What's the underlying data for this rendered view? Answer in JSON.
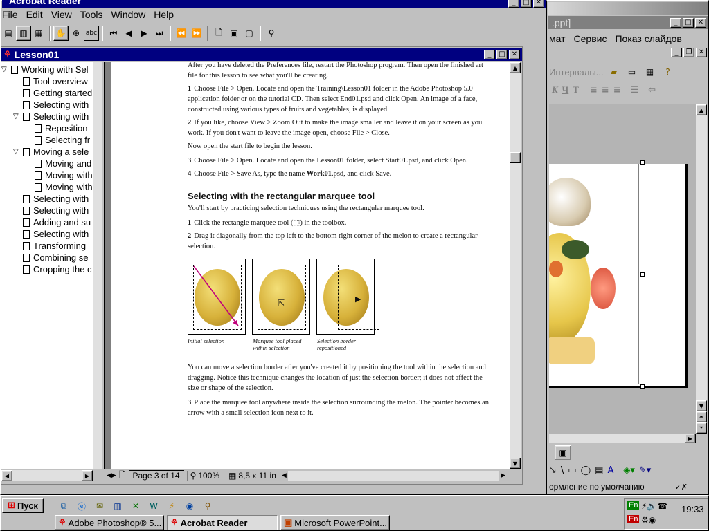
{
  "acrobat": {
    "title": "Acrobat Reader",
    "menu": [
      "File",
      "Edit",
      "View",
      "Tools",
      "Window",
      "Help"
    ],
    "doc_window_title": "Lesson01",
    "bookmarks": [
      {
        "label": "Working with Sel",
        "level": 0,
        "expanded": true
      },
      {
        "label": "Tool overview",
        "level": 1
      },
      {
        "label": "Getting started",
        "level": 1
      },
      {
        "label": "Selecting with",
        "level": 1
      },
      {
        "label": "Selecting with",
        "level": 1,
        "expanded": true
      },
      {
        "label": "Reposition",
        "level": 2
      },
      {
        "label": "Selecting fr",
        "level": 2
      },
      {
        "label": "Moving a sele",
        "level": 1,
        "expanded": true
      },
      {
        "label": "Moving and",
        "level": 2
      },
      {
        "label": "Moving with",
        "level": 2
      },
      {
        "label": "Moving with",
        "level": 2
      },
      {
        "label": "Selecting with",
        "level": 1
      },
      {
        "label": "Selecting with",
        "level": 1
      },
      {
        "label": "Adding and su",
        "level": 1
      },
      {
        "label": "Selecting with",
        "level": 1
      },
      {
        "label": "Transforming",
        "level": 1
      },
      {
        "label": "Combining se",
        "level": 1
      },
      {
        "label": "Cropping the c",
        "level": 1
      }
    ],
    "status": {
      "page": "Page 3 of 14",
      "zoom": "100%",
      "size": "8,5 x 11 in"
    },
    "document": {
      "p0": "After you have deleted the Preferences file, restart the Photoshop program. Then open the finished art file for this lesson to see what you'll be creating.",
      "s1_num": "1",
      "s1": "Choose File > Open. Locate and open the Training\\Lesson01 folder in the Adobe Photoshop 5.0 application folder or on the tutorial CD. Then select End01.psd and click Open. An image of a face, constructed using various types of fruits and vegetables, is displayed.",
      "s2_num": "2",
      "s2": "If you like, choose View > Zoom Out to make the image smaller and leave it on your screen as you work. If you don't want to leave the image open, choose File > Close.",
      "p1": "Now open the start file to begin the lesson.",
      "s3_num": "3",
      "s3": "Choose File > Open. Locate and open the Lesson01 folder, select Start01.psd, and click Open.",
      "s4_num": "4",
      "s4_pre": "Choose File > Save As, type the name ",
      "s4_bold": "Work01",
      "s4_post": ".psd, and click Save.",
      "heading": "Selecting with the rectangular marquee tool",
      "p2": "You'll start by practicing selection techniques using the rectangular marquee tool.",
      "t1_num": "1",
      "t1": "Click the rectangle marquee tool (⬚) in the toolbox.",
      "t2_num": "2",
      "t2": "Drag it diagonally from the top left to the bottom right corner of the melon to create a rectangular selection.",
      "captions": [
        "Initial selection",
        "Marquee tool placed within selection",
        "Selection border repositioned"
      ],
      "p3": "You can move a selection border after you've created it by positioning the tool within the selection and dragging. Notice this technique changes the location of just the selection border; it does not affect the size or shape of the selection.",
      "t3_num": "3",
      "t3": "Place the marquee tool anywhere inside the selection surrounding the melon. The pointer becomes an arrow with a small selection icon next to it."
    }
  },
  "powerpoint": {
    "title_fragment": ".ppt]",
    "menu": [
      "мат",
      "Сервис",
      "Показ слайдов"
    ],
    "font_field": "Интервалы...",
    "status": "ормление по умолчанию"
  },
  "taskbar": {
    "start": "Пуск",
    "tasks": [
      "Adobe Photoshop® 5...",
      "Acrobat Reader",
      "Microsoft PowerPoint..."
    ],
    "lang1": "En",
    "lang2": "En",
    "time": "19:33"
  },
  "colors": {
    "titlebar": "#000080",
    "desktop": "#008080",
    "face": "#c0c0c0"
  }
}
